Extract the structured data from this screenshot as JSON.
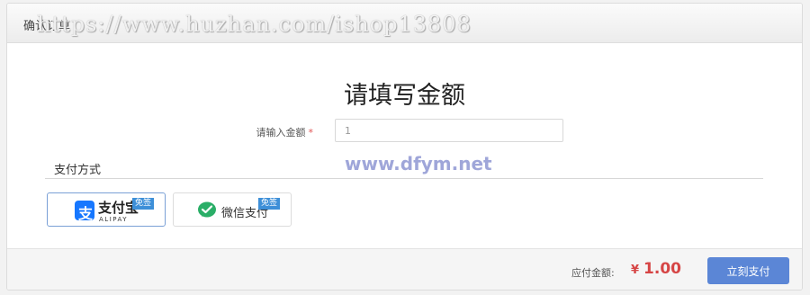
{
  "header": {
    "title": "确认订单",
    "watermark": "https://www.huzhan.com/ishop13808"
  },
  "form": {
    "title": "请填写金额",
    "amount_label": "请输入金额",
    "required_mark": "*",
    "amount_value": "1"
  },
  "payment": {
    "section_title": "支付方式",
    "watermark": "www.dfym.net",
    "options": [
      {
        "name": "支付宝",
        "sub": "ALIPAY",
        "badge": "免签",
        "selected": true,
        "icon": "alipay-icon",
        "color": "#1677ff"
      },
      {
        "name": "微信支付",
        "badge": "免签",
        "selected": false,
        "icon": "wechat-icon",
        "color": "#2aae67"
      }
    ]
  },
  "footer": {
    "due_label": "应付金额:",
    "currency": "¥",
    "due_amount": "1.00",
    "pay_button": "立刻支付"
  }
}
